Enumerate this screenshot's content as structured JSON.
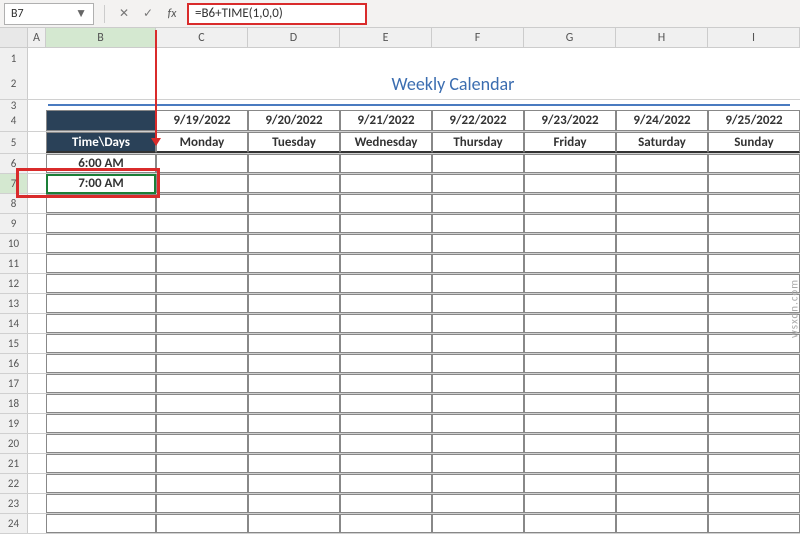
{
  "nameBox": {
    "value": "B7"
  },
  "formulaBar": {
    "value": "=B6+TIME(1,0,0)"
  },
  "columns": [
    "A",
    "B",
    "C",
    "D",
    "E",
    "F",
    "G",
    "H",
    "I"
  ],
  "rowNumbers": [
    "1",
    "2",
    "3",
    "4",
    "5",
    "6",
    "7",
    "8",
    "9",
    "10",
    "11",
    "12",
    "13",
    "14",
    "15",
    "16",
    "17",
    "18",
    "19",
    "20",
    "21",
    "22",
    "23",
    "24"
  ],
  "title": "Weekly Calendar",
  "dates": [
    "9/19/2022",
    "9/20/2022",
    "9/21/2022",
    "9/22/2022",
    "9/23/2022",
    "9/24/2022",
    "9/25/2022"
  ],
  "days": [
    "Monday",
    "Tuesday",
    "Wednesday",
    "Thursday",
    "Friday",
    "Saturday",
    "Sunday"
  ],
  "timeHeader": "Time\\Days",
  "times": [
    "6:00 AM",
    "7:00 AM"
  ],
  "watermark": "wsxdn.com",
  "icons": {
    "cancel": "✕",
    "confirm": "✓",
    "fx": "fx",
    "dropdown": "▼"
  }
}
